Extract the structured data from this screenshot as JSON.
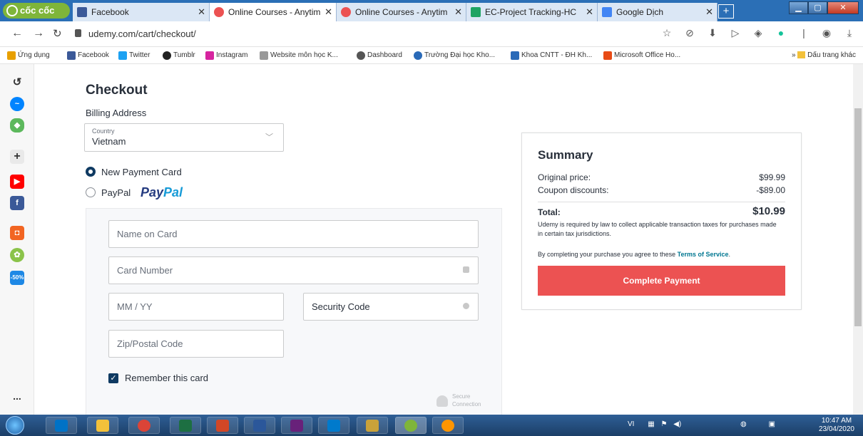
{
  "browser": {
    "brand": "cốc cốc",
    "tabs": [
      {
        "title": "Facebook",
        "icon": "facebook-icon"
      },
      {
        "title": "Online Courses - Anytim",
        "icon": "udemy-icon"
      },
      {
        "title": "Online Courses - Anytim",
        "icon": "udemy-icon"
      },
      {
        "title": "EC-Project Tracking-HC",
        "icon": "sheets-icon"
      },
      {
        "title": "Google Dịch",
        "icon": "translate-icon"
      }
    ],
    "new_tab": "+",
    "url": "udemy.com/cart/checkout/",
    "bookmarks": [
      "Ứng dụng",
      "Facebook",
      "Twitter",
      "Tumblr",
      "Instagram",
      "Website môn học K...",
      "Dashboard",
      "Trường Đại học Kho...",
      "Khoa CNTT - ĐH Kh...",
      "Microsoft Office Ho..."
    ],
    "bookmarks_more": "»",
    "bookmarks_other": "Dấu trang khác"
  },
  "sidebar": {
    "icons": [
      "history-icon",
      "messenger-icon",
      "game-icon",
      "add-icon",
      "youtube-icon",
      "facebook-icon",
      "shop-icon",
      "leaf-icon",
      "sale-icon"
    ],
    "sale_badge": "-50%",
    "more": "..."
  },
  "checkout": {
    "title": "Checkout",
    "billing_address": "Billing Address",
    "country_label": "Country",
    "country_value": "Vietnam",
    "payment_options": [
      {
        "label": "New Payment Card",
        "selected": true
      },
      {
        "label": "PayPal",
        "selected": false
      }
    ],
    "paypal_logo": {
      "pay": "Pay",
      "pal": "Pal"
    },
    "fields": {
      "name": "Name on Card",
      "number": "Card Number",
      "expiry": "MM / YY",
      "security": "Security Code",
      "zip": "Zip/Postal Code"
    },
    "remember": "Remember this card",
    "secure_line1": "Secure",
    "secure_line2": "Connection"
  },
  "summary": {
    "title": "Summary",
    "original_label": "Original price:",
    "original_value": "$99.99",
    "coupon_label": "Coupon discounts:",
    "coupon_value": "-$89.00",
    "total_label": "Total:",
    "total_value": "$10.99",
    "tax_note": "Udemy is required by law to collect applicable transaction taxes for purchases made in certain tax jurisdictions.",
    "tos_prefix": "By completing your purchase you agree to these",
    "tos_link": "Terms of Service",
    "tos_suffix": ".",
    "button": "Complete Payment"
  },
  "taskbar": {
    "lang": "VI",
    "time": "10:47 AM",
    "date": "23/04/2020"
  },
  "colors": {
    "primary_button": "#ec5252",
    "link": "#007791",
    "radio_checked": "#0f3a62"
  }
}
